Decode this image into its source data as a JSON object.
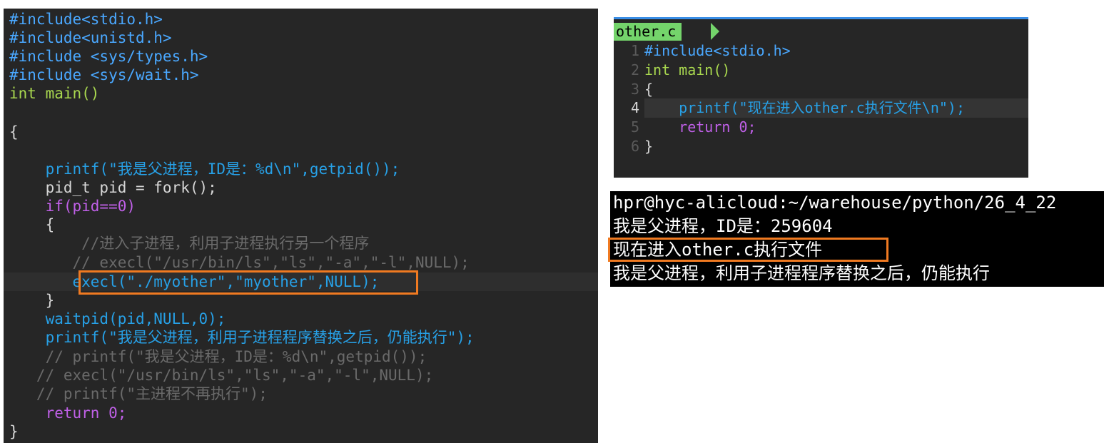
{
  "left_editor": {
    "lines": [
      {
        "text": "#include<stdio.h>"
      },
      {
        "text": "#include<unistd.h>"
      },
      {
        "text": "#include <sys/types.h>"
      },
      {
        "text": "#include <sys/wait.h>"
      },
      {
        "text": "int main()"
      },
      {
        "text": ""
      },
      {
        "text": "{"
      },
      {
        "text": ""
      },
      {
        "text": "    printf(\"我是父进程，ID是：%d\\n\",getpid());"
      },
      {
        "text": "    pid_t pid = fork();"
      },
      {
        "text": "    if(pid==0)"
      },
      {
        "text": "    {"
      },
      {
        "text": "        //进入子进程，利用子进程执行另一个程序"
      },
      {
        "text": "       // execl(\"/usr/bin/ls\",\"ls\",\"-a\",\"-l\",NULL);"
      },
      {
        "text": "       execl(\"./myother\",\"myother\",NULL);"
      },
      {
        "text": "    }"
      },
      {
        "text": "    waitpid(pid,NULL,0);"
      },
      {
        "text": "    printf(\"我是父进程，利用子进程程序替换之后，仍能执行\");"
      },
      {
        "text": "    // printf(\"我是父进程，ID是：%d\\n\",getpid());"
      },
      {
        "text": "   // execl(\"/usr/bin/ls\",\"ls\",\"-a\",\"-l\",NULL);"
      },
      {
        "text": "   // printf(\"主进程不再执行\");"
      },
      {
        "text": "    return 0;"
      },
      {
        "text": "}"
      }
    ]
  },
  "right_editor": {
    "filename": "other.c",
    "line_numbers": [
      "1",
      "2",
      "3",
      "4",
      "5",
      "6"
    ],
    "lines": [
      {
        "text": "#include<stdio.h>"
      },
      {
        "text": "int main()"
      },
      {
        "text": "{"
      },
      {
        "text": "    printf(\"现在进入other.c执行文件\\n\");"
      },
      {
        "text": "    return 0;"
      },
      {
        "text": "}"
      }
    ]
  },
  "terminal": {
    "lines": [
      "hpr@hyc-alicloud:~/warehouse/python/26_4_22",
      "我是父进程，ID是：259604",
      "现在进入other.c执行文件",
      "我是父进程，利用子进程程序替换之后，仍能执行"
    ]
  },
  "colors": {
    "editor_bg": "#262626",
    "highlight_box": "#f07a21",
    "tab_green": "#74d46b",
    "cursor_green": "#1fd40a"
  }
}
